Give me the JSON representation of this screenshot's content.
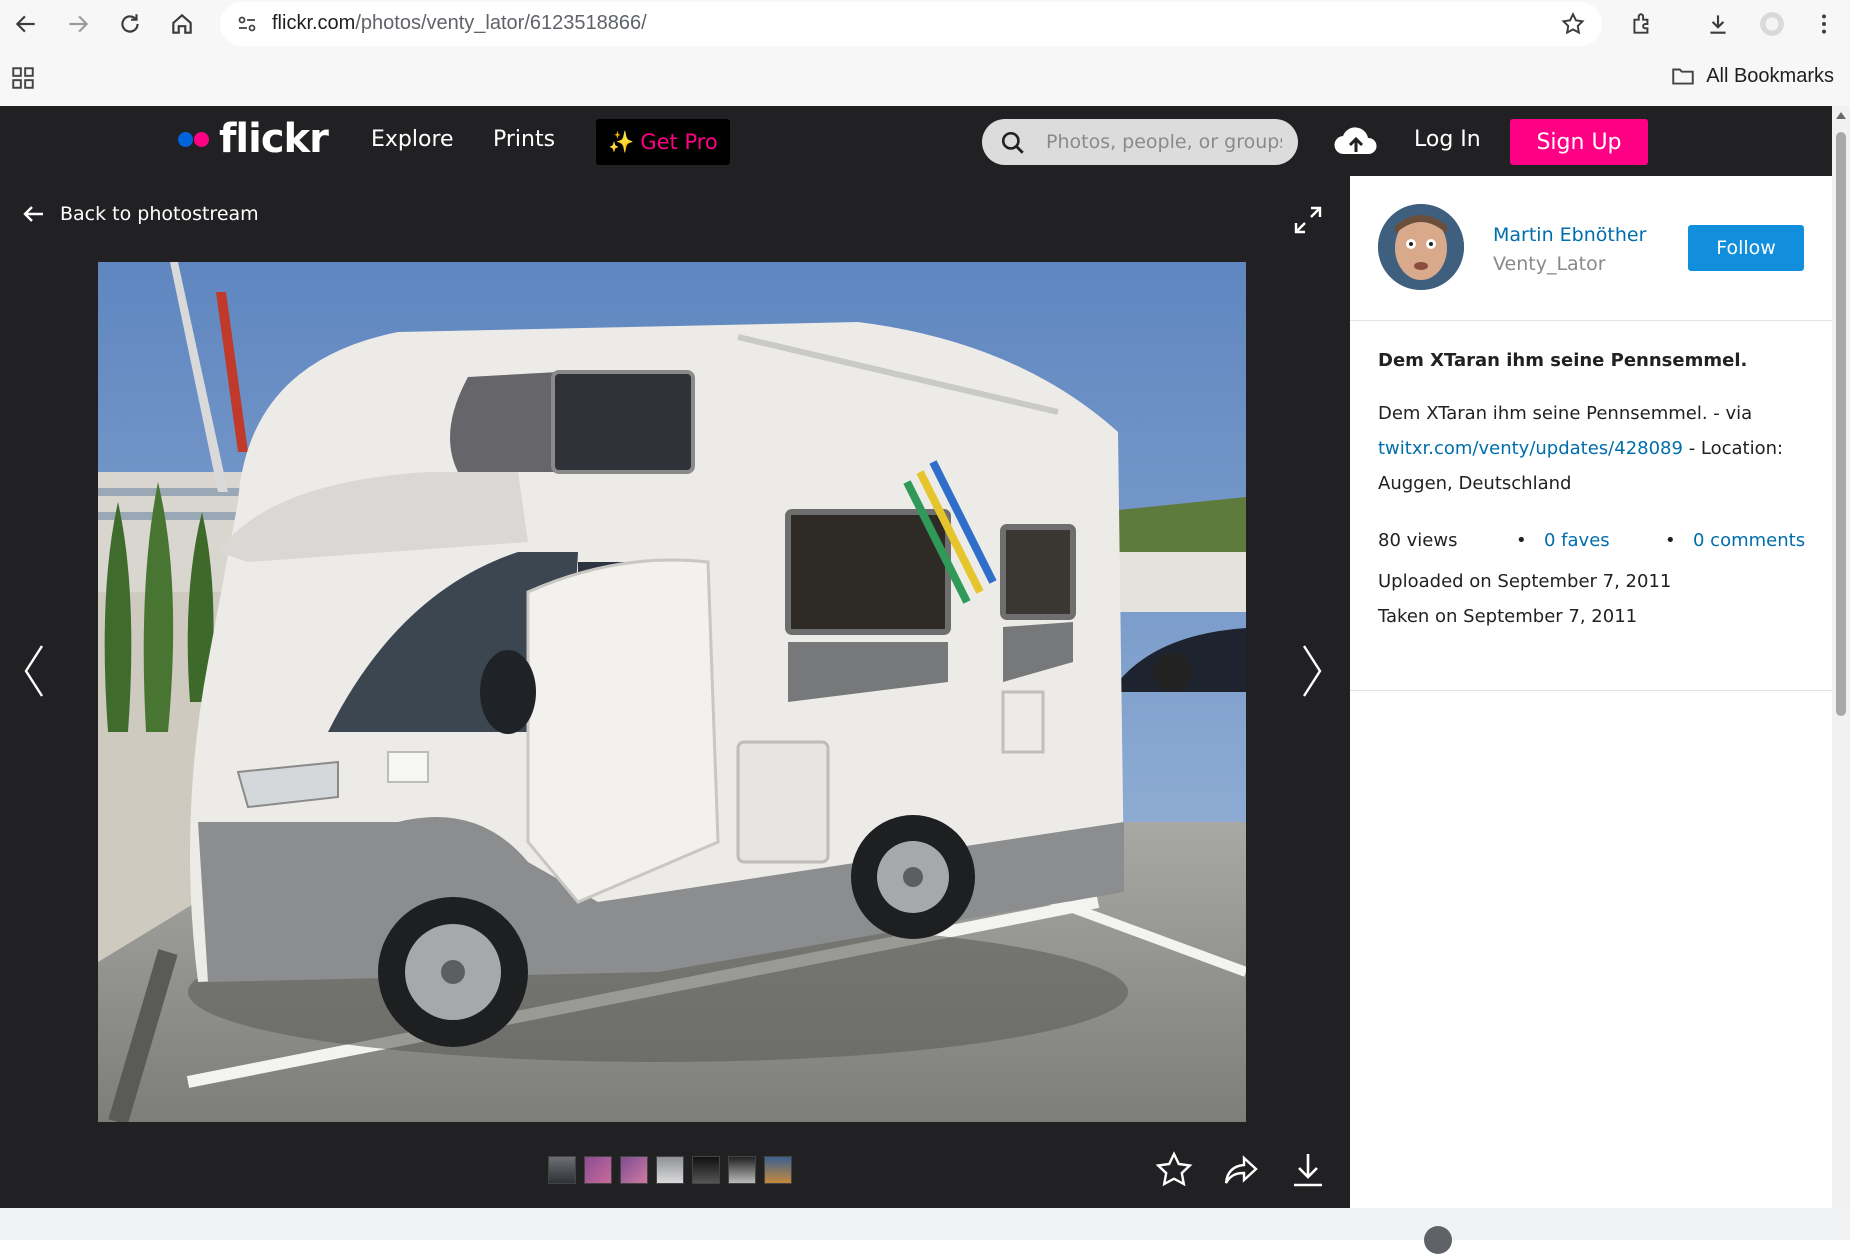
{
  "browser": {
    "url_domain": "flickr.com",
    "url_path": "/photos/venty_lator/6123518866/",
    "bookmarks_label": "All Bookmarks"
  },
  "header": {
    "logo": "flickr",
    "nav": {
      "explore": "Explore",
      "prints": "Prints",
      "get_pro": "Get Pro",
      "get_pro_icon": "✨"
    },
    "search_placeholder": "Photos, people, or groups",
    "login": "Log In",
    "signup": "Sign Up",
    "colors": {
      "brand_blue": "#0063dc",
      "brand_pink": "#ff0084",
      "follow_blue": "#128fdc"
    }
  },
  "photo_area": {
    "back_label": "Back to photostream"
  },
  "sidebar": {
    "owner_name": "Martin Ebnöther",
    "owner_handle": "Venty_Lator",
    "follow_label": "Follow",
    "title": "Dem XTaran ihm seine Pennsemmel.",
    "description": {
      "before_link": "Dem XTaran ihm seine Pennsemmel. - via",
      "link": "twitxr.com/venty/updates/428089",
      "after_link": " - Location: Auggen, Deutschland"
    },
    "stats": {
      "views": "80 views",
      "faves": "0 faves",
      "comments": "0 comments",
      "uploaded": "Uploaded on September 7, 2011",
      "taken": "Taken on September 7, 2011"
    }
  }
}
